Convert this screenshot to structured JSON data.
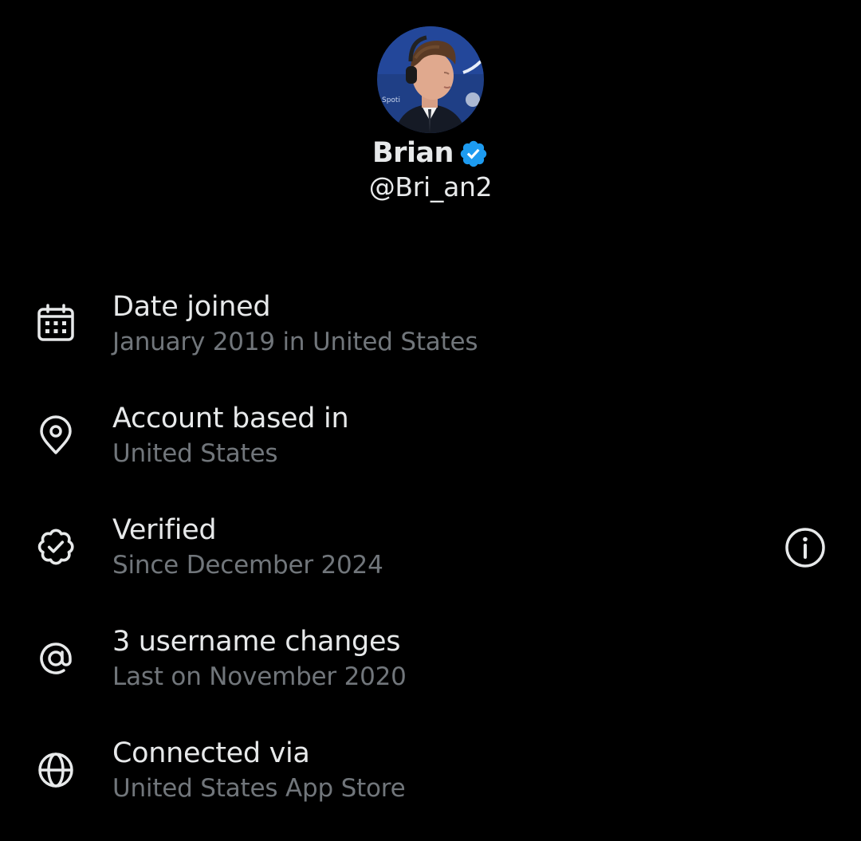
{
  "profile": {
    "display_name": "Brian",
    "handle": "@Bri_an2",
    "avatar_icon": "avatar-photo",
    "verified_icon": "verified-badge-icon",
    "verified_color": "#1d9bf0"
  },
  "about": {
    "items": [
      {
        "icon": "calendar-icon",
        "title": "Date joined",
        "subtitle": "January 2019 in United States"
      },
      {
        "icon": "location-pin-icon",
        "title": "Account based in",
        "subtitle": "United States"
      },
      {
        "icon": "verified-outline-icon",
        "title": "Verified",
        "subtitle": "Since December 2024",
        "action_icon": "info-icon"
      },
      {
        "icon": "at-sign-icon",
        "title": "3 username changes",
        "subtitle": "Last on November 2020"
      },
      {
        "icon": "globe-icon",
        "title": "Connected via",
        "subtitle": "United States App Store"
      }
    ]
  },
  "colors": {
    "background": "#000000",
    "primary_text": "#e7e9ea",
    "secondary_text": "#71767b",
    "accent": "#1d9bf0"
  }
}
